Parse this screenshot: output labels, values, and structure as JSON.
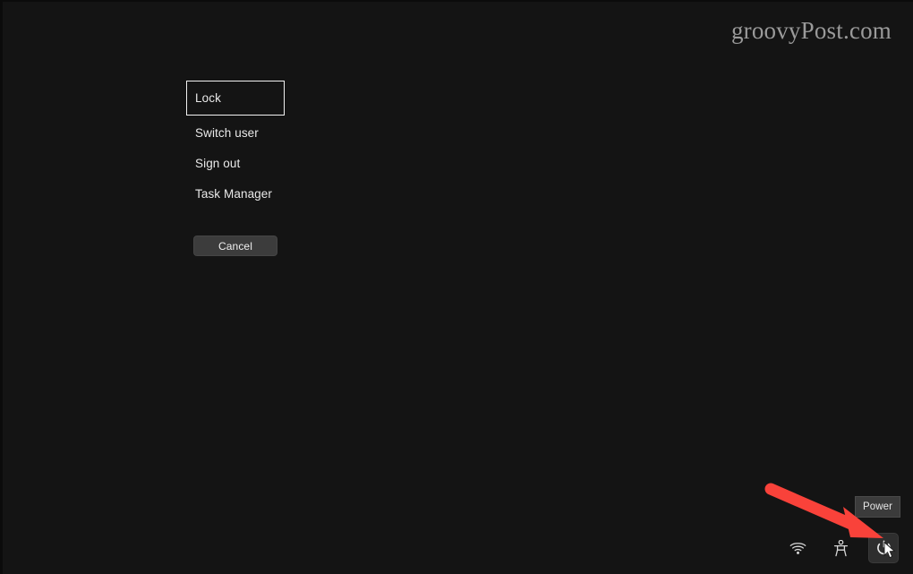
{
  "screen": {
    "background_color": "#141414",
    "platform_label": "Windows security options screen"
  },
  "watermark": {
    "text": "groovyPost.com",
    "color": "#9a9a9a"
  },
  "security_options": {
    "items": [
      {
        "label": "Lock",
        "focused": true
      },
      {
        "label": "Switch user",
        "focused": false
      },
      {
        "label": "Sign out",
        "focused": false
      },
      {
        "label": "Task Manager",
        "focused": false
      }
    ],
    "focus_ring_color": "#f2f2f2",
    "text_color": "#e9e9e9"
  },
  "cancel": {
    "label": "Cancel",
    "background_color": "#3c3c3c",
    "text_color": "#efefef"
  },
  "utility_bar": {
    "buttons": [
      {
        "name": "network-icon",
        "label": "Network",
        "hovered": false
      },
      {
        "name": "accessibility-icon",
        "label": "Accessibility",
        "hovered": false
      },
      {
        "name": "power-icon",
        "label": "Power",
        "hovered": true
      }
    ],
    "hover_background_color": "#2e2e2e",
    "icon_color": "#e0e0e0"
  },
  "tooltip": {
    "text": "Power",
    "background_color": "#3b3b3b",
    "text_color": "#e6e6e6"
  },
  "annotation": {
    "type": "arrow",
    "color": "#f9423a",
    "points_to": "power-button",
    "description": "red arrow pointing down-right at the power button"
  }
}
